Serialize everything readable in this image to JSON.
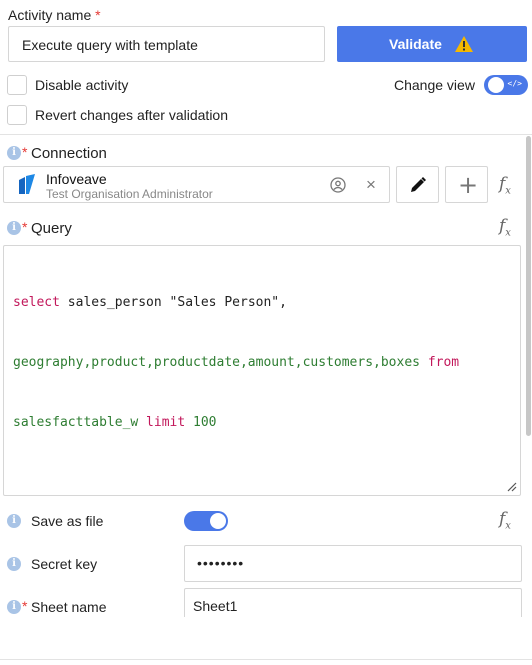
{
  "activity": {
    "label": "Activity name",
    "required_mark": "*",
    "value": "Execute query with template",
    "validate_label": "Validate"
  },
  "options": {
    "disable_activity": "Disable activity",
    "revert_changes": "Revert changes after validation",
    "change_view": "Change view",
    "change_view_on": true
  },
  "connection": {
    "info": "i",
    "required_mark": "*",
    "label": "Connection",
    "name": "Infoveave",
    "subtitle": "Test Organisation Administrator",
    "clear": "×",
    "add": "+"
  },
  "query": {
    "info": "i",
    "required_mark": "*",
    "label": "Query",
    "line1": {
      "t1": "select",
      "t2": " sales_person ",
      "t3": "\"Sales Person\"",
      "t4": ","
    },
    "line2": {
      "t1": "geography,product,productdate,amount,customers,boxes",
      "t2": " from"
    },
    "line3": {
      "t1": "salesfacttable_w",
      "t2": " limit",
      "t3": " 100"
    }
  },
  "save_as_file": {
    "info": "i",
    "label": "Save as file",
    "enabled": true
  },
  "secret_key": {
    "info": "i",
    "label": "Secret key",
    "value": "••••••••"
  },
  "sheet_name": {
    "info": "i",
    "required_mark": "*",
    "label": "Sheet name",
    "value": "Sheet1"
  },
  "fx": {
    "f": "f",
    "x": "x"
  },
  "colors": {
    "accent": "#4a78e8",
    "required": "#e53935",
    "warning": "#f5b800"
  }
}
